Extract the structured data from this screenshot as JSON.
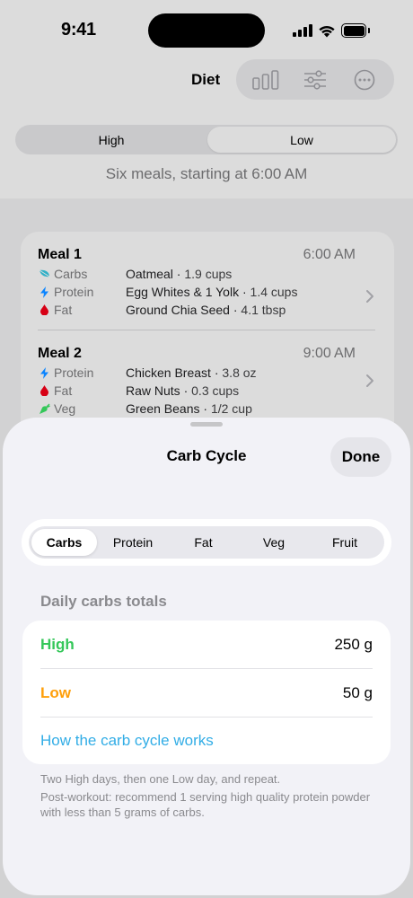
{
  "status_bar": {
    "time": "9:41"
  },
  "nav": {
    "title": "Diet",
    "icons": [
      "bar-chart-icon",
      "sliders-icon",
      "more-icon"
    ]
  },
  "segment": {
    "options": [
      "High",
      "Low"
    ],
    "selected": "Low"
  },
  "subtitle": "Six meals, starting at 6:00 AM",
  "meals": [
    {
      "title": "Meal 1",
      "time": "6:00 AM",
      "rows": [
        {
          "macro": "Carbs",
          "icon": "carbs-leaf-icon",
          "food": "Oatmeal",
          "detail": "1.9 cups"
        },
        {
          "macro": "Protein",
          "icon": "protein-bolt-icon",
          "food": "Egg Whites & 1 Yolk",
          "detail": "1.4 cups"
        },
        {
          "macro": "Fat",
          "icon": "fat-drop-icon",
          "food": "Ground Chia Seed",
          "detail": "4.1 tbsp"
        }
      ]
    },
    {
      "title": "Meal 2",
      "time": "9:00 AM",
      "rows": [
        {
          "macro": "Protein",
          "icon": "protein-bolt-icon",
          "food": "Chicken Breast",
          "detail": "3.8 oz"
        },
        {
          "macro": "Fat",
          "icon": "fat-drop-icon",
          "food": "Raw Nuts",
          "detail": "0.3 cups"
        },
        {
          "macro": "Veg",
          "icon": "veg-carrot-icon",
          "food": "Green Beans",
          "detail": "1/2 cup"
        }
      ]
    }
  ],
  "sheet": {
    "title": "Carb Cycle",
    "done_label": "Done",
    "tabs": [
      "Carbs",
      "Protein",
      "Fat",
      "Veg",
      "Fruit"
    ],
    "active_tab": "Carbs",
    "section_label": "Daily carbs totals",
    "totals": [
      {
        "label": "High",
        "value": "250 g",
        "color": "#34c759"
      },
      {
        "label": "Low",
        "value": "50 g",
        "color": "#ff9f0a"
      }
    ],
    "link_label": "How the carb cycle works",
    "link_color": "#32ade6",
    "footnotes": [
      "Two High days, then one Low day, and repeat.",
      "Post-workout: recommend 1 serving high quality protein powder with less than 5 grams of carbs."
    ]
  }
}
